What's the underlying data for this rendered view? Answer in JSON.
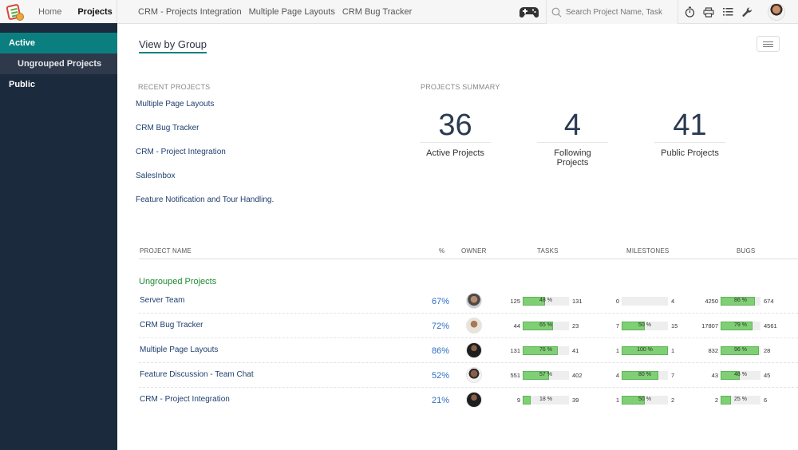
{
  "topbar": {
    "nav": {
      "home": "Home",
      "projects": "Projects"
    },
    "recent_tabs": [
      "CRM - Projects Integration",
      "Multiple Page Layouts",
      "CRM Bug Tracker"
    ],
    "search": {
      "placeholder": "Search Project Name, Task",
      "value": ""
    },
    "icons": [
      "gamepad-icon",
      "search-icon",
      "timer-icon",
      "print-icon",
      "list-icon",
      "wrench-icon",
      "user-avatar"
    ]
  },
  "sidebar": {
    "items": [
      {
        "label": "Active",
        "state": "active"
      },
      {
        "label": "Ungrouped Projects",
        "state": "sub"
      },
      {
        "label": "Public",
        "state": "normal"
      }
    ]
  },
  "main": {
    "view_title": "View by Group",
    "recent": {
      "label": "RECENT PROJECTS",
      "items": [
        "Multiple Page Layouts",
        "CRM Bug Tracker",
        "CRM - Project Integration",
        "SalesInbox",
        "Feature Notification and Tour Handling."
      ]
    },
    "summary": {
      "label": "PROJECTS SUMMARY",
      "stats": [
        {
          "value": "36",
          "label": "Active Projects"
        },
        {
          "value": "4",
          "label": "Following Projects"
        },
        {
          "value": "41",
          "label": "Public Projects"
        }
      ]
    },
    "table": {
      "headers": {
        "name": "PROJECT NAME",
        "pct": "%",
        "owner": "OWNER",
        "tasks": "TASKS",
        "milestones": "MILESTONES",
        "bugs": "BUGS"
      },
      "group": "Ungrouped Projects",
      "rows": [
        {
          "name": "Server Team",
          "pct": "67%",
          "tasks": {
            "open": "125",
            "closed": "131",
            "percent": 48,
            "label": "48 %"
          },
          "milestones": {
            "open": "0",
            "closed": "4",
            "percent": 0,
            "label": ""
          },
          "bugs": {
            "open": "4250",
            "closed": "674",
            "percent": 86,
            "label": "86 %"
          }
        },
        {
          "name": "CRM Bug Tracker",
          "pct": "72%",
          "tasks": {
            "open": "44",
            "closed": "23",
            "percent": 65,
            "label": "65 %"
          },
          "milestones": {
            "open": "7",
            "closed": "15",
            "percent": 50,
            "label": "50 %"
          },
          "bugs": {
            "open": "17807",
            "closed": "4561",
            "percent": 79,
            "label": "79 %"
          }
        },
        {
          "name": "Multiple Page Layouts",
          "pct": "86%",
          "tasks": {
            "open": "131",
            "closed": "41",
            "percent": 76,
            "label": "76 %"
          },
          "milestones": {
            "open": "1",
            "closed": "1",
            "percent": 100,
            "label": "100 %"
          },
          "bugs": {
            "open": "832",
            "closed": "28",
            "percent": 96,
            "label": "96 %"
          }
        },
        {
          "name": "Feature Discussion - Team Chat",
          "pct": "52%",
          "tasks": {
            "open": "551",
            "closed": "402",
            "percent": 57,
            "label": "57 %"
          },
          "milestones": {
            "open": "4",
            "closed": "7",
            "percent": 80,
            "label": "80 %"
          },
          "bugs": {
            "open": "43",
            "closed": "45",
            "percent": 48,
            "label": "48 %"
          }
        },
        {
          "name": "CRM - Project Integration",
          "pct": "21%",
          "tasks": {
            "open": "9",
            "closed": "39",
            "percent": 18,
            "label": "18 %"
          },
          "milestones": {
            "open": "1",
            "closed": "2",
            "percent": 50,
            "label": "50 %"
          },
          "bugs": {
            "open": "2",
            "closed": "6",
            "percent": 25,
            "label": "25 %"
          }
        }
      ]
    }
  },
  "colors": {
    "sidebar_bg": "#1b2a3c",
    "active_teal": "#0b7f80",
    "link_blue": "#1e3f6e",
    "pct_blue": "#2f6fc1",
    "group_green": "#1e8a34",
    "bar_green": "#7fcf74"
  }
}
